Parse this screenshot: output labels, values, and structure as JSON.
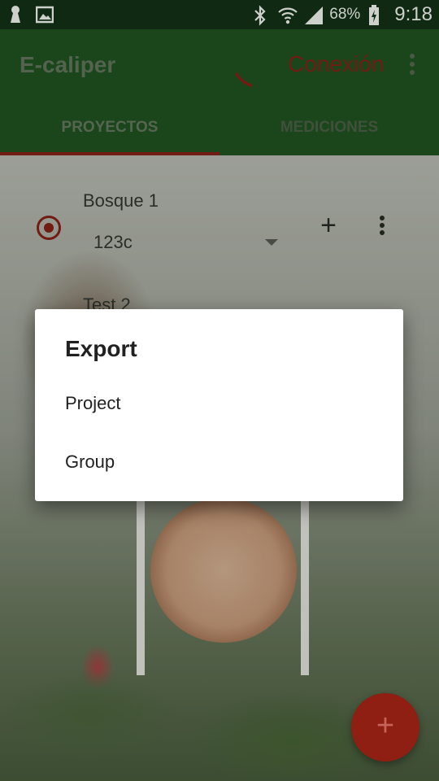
{
  "status_bar": {
    "battery_percent": "68%",
    "time": "9:18",
    "icons": [
      "notification-icon",
      "image-icon",
      "bluetooth-icon",
      "wifi-icon",
      "cell-signal-icon",
      "battery-charging-icon"
    ]
  },
  "app_bar": {
    "title": "E-caliper",
    "connection_label": "Conexión",
    "tabs": [
      {
        "label": "PROYECTOS",
        "selected": true
      },
      {
        "label": "MEDICIONES",
        "selected": false
      }
    ],
    "colors": {
      "bar": "#1a4a1a",
      "accent": "#7a1a12"
    }
  },
  "projects": [
    {
      "name": "Bosque 1",
      "selected_group": "123c",
      "selected": true
    },
    {
      "name": "Test 2"
    }
  ],
  "dialog": {
    "title": "Export",
    "options": [
      "Project",
      "Group"
    ]
  },
  "fab": {
    "icon": "plus-icon",
    "color": "#8e1f12"
  }
}
